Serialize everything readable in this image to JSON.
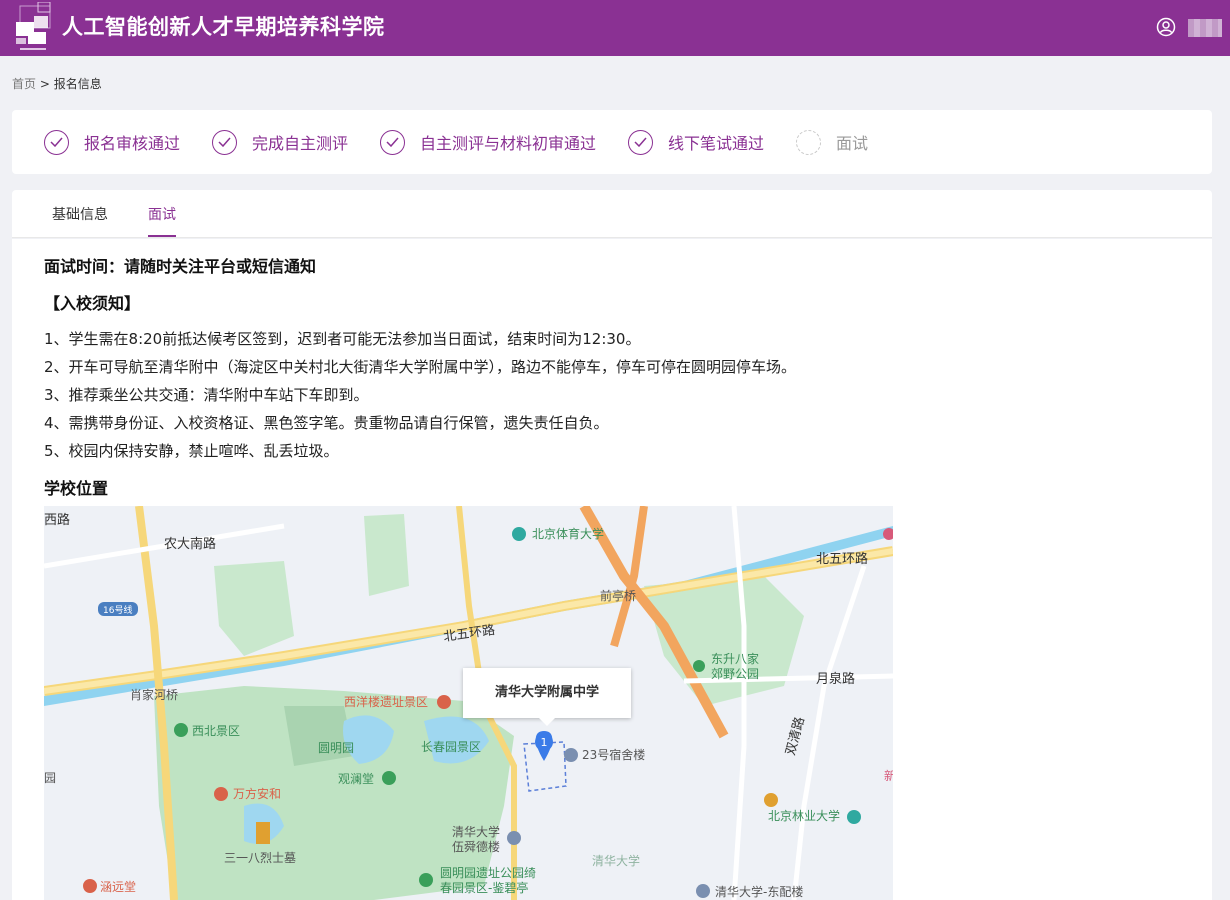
{
  "header": {
    "title": "人工智能创新人才早期培养科学院",
    "logo_icon": "logo-icon",
    "user_icon": "user-circle-icon",
    "accent_color": "#8a3193"
  },
  "breadcrumb": {
    "home": "首页",
    "separator": ">",
    "current": "报名信息"
  },
  "steps": [
    {
      "label": "报名审核通过",
      "done": true
    },
    {
      "label": "完成自主测评",
      "done": true
    },
    {
      "label": "自主测评与材料初审通过",
      "done": true
    },
    {
      "label": "线下笔试通过",
      "done": true
    },
    {
      "label": "面试",
      "done": false
    }
  ],
  "tabs": [
    {
      "label": "基础信息",
      "active": false
    },
    {
      "label": "面试",
      "active": true
    }
  ],
  "content": {
    "interview_time": "面试时间：请随时关注平台或短信通知",
    "notice_title": "【入校须知】",
    "notices": [
      "1、学生需在8:20前抵达候考区签到，迟到者可能无法参加当日面试，结束时间为12:30。",
      "2、开车可导航至清华附中（海淀区中关村北大街清华大学附属中学），路边不能停车，停车可停在圆明园停车场。",
      "3、推荐乘坐公共交通：清华附中车站下车即到。",
      "4、需携带身份证、入校资格证、黑色签字笔。贵重物品请自行保管，遗失责任自负。",
      "5、校园内保持安静，禁止喧哗、乱丢垃圾。"
    ],
    "location_title": "学校位置"
  },
  "map": {
    "popup": "清华大学附属中学",
    "marker": "1",
    "labels": {
      "xilu": "西路",
      "nongda": "农大南路",
      "tiyu": "北京体育大学",
      "bei5_right": "北五环路",
      "bei5_center": "北五环路",
      "qianting": "前亭桥",
      "road16": "16号线",
      "dongsheng": "东升八家",
      "jiaoye": "郊野公园",
      "yuequan": "月泉路",
      "xiaojia": "肖家河桥",
      "xiyang": "西洋楼遗址景区",
      "xibei": "西北景区",
      "yuanming": "圆明园",
      "changchun": "长春园景区",
      "sushe": "23号宿舍楼",
      "shuangqing": "双清路",
      "guanlan": "观澜堂",
      "yuan": "园",
      "fangfang": "万方安和",
      "qinghua_wuxun1": "清华大学",
      "qinghua_wuxun2": "伍舜德楼",
      "linye": "北京林业大学",
      "xin": "新",
      "lieshi": "三一八烈士墓",
      "yuanmingyuan1": "圆明园遗址公园绮",
      "yuanmingyuan2": "春园景区-鉴碧亭",
      "qinghua": "清华大学",
      "hanyuan": "涵远堂",
      "dongpei": "清华大学-东配楼"
    }
  }
}
